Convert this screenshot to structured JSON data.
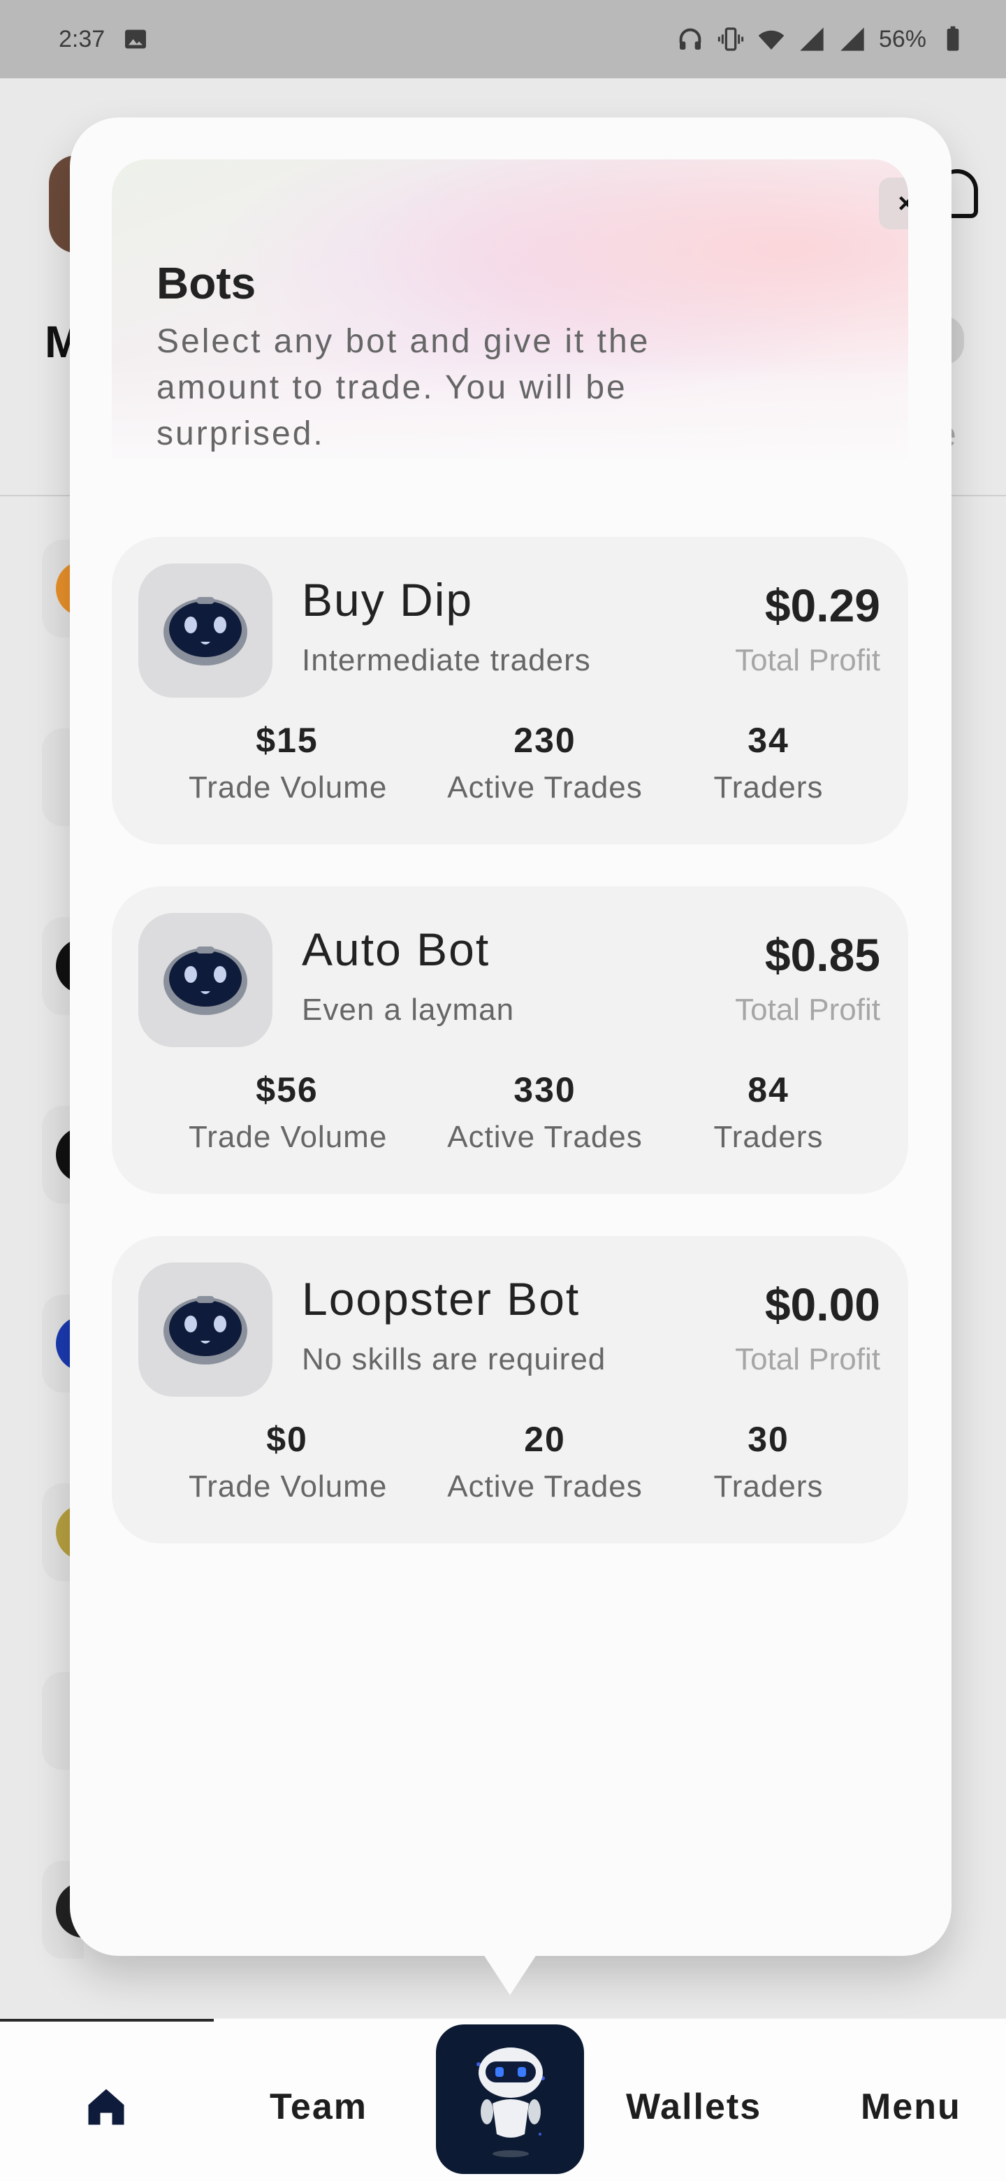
{
  "status_bar": {
    "time": "2:37",
    "battery": "56%",
    "icons": [
      "image-icon",
      "headphones-icon",
      "vibrate-icon",
      "wifi-icon",
      "signal-icon",
      "signal-icon",
      "battery-icon"
    ]
  },
  "modal": {
    "title": "Bots",
    "subtitle": "Select any bot and give it the amount to trade. You will be surprised.",
    "close_label": "×"
  },
  "bots": [
    {
      "name": "Buy Dip",
      "description": "Intermediate traders",
      "profit": "$0.29",
      "profit_label": "Total Profit",
      "trade_volume": "$15",
      "trade_volume_label": "Trade Volume",
      "active_trades": "230",
      "active_trades_label": "Active Trades",
      "traders": "34",
      "traders_label": "Traders"
    },
    {
      "name": "Auto Bot",
      "description": "Even a layman",
      "profit": "$0.85",
      "profit_label": "Total Profit",
      "trade_volume": "$56",
      "trade_volume_label": "Trade Volume",
      "active_trades": "330",
      "active_trades_label": "Active Trades",
      "traders": "84",
      "traders_label": "Traders"
    },
    {
      "name": "Loopster Bot",
      "description": "No skills are required",
      "profit": "$0.00",
      "profit_label": "Total Profit",
      "trade_volume": "$0",
      "trade_volume_label": "Trade Volume",
      "active_trades": "20",
      "active_trades_label": "Active Trades",
      "traders": "30",
      "traders_label": "Traders"
    }
  ],
  "nav": {
    "home_icon": "home-icon",
    "team": "Team",
    "center_icon": "robot-icon",
    "wallets": "Wallets",
    "menu": "Menu"
  },
  "colors": {
    "accent_dark": "#0c1a33",
    "card_bg": "#f2f2f2",
    "header_pink": "#fbd6da"
  }
}
